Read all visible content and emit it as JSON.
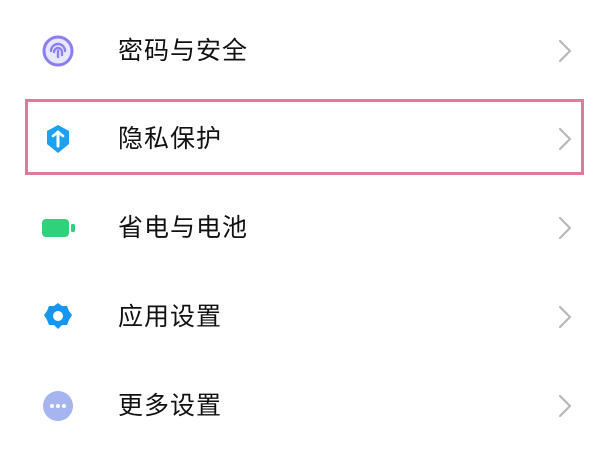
{
  "settings": {
    "items": [
      {
        "label": "密码与安全",
        "icon": "fingerprint-icon"
      },
      {
        "label": "隐私保护",
        "icon": "shield-icon"
      },
      {
        "label": "省电与电池",
        "icon": "battery-icon"
      },
      {
        "label": "应用设置",
        "icon": "gear-icon"
      },
      {
        "label": "更多设置",
        "icon": "more-dots-icon"
      }
    ],
    "highlighted_item": "隐私保护"
  },
  "colors": {
    "fingerprint": "#8a7ff0",
    "shield": "#1ba1ee",
    "battery": "#2fd17b",
    "gear": "#1696ee",
    "more": "#a6b4ef",
    "highlight": "#e1789e",
    "chevron": "#b8b8b8",
    "text": "#111111"
  }
}
